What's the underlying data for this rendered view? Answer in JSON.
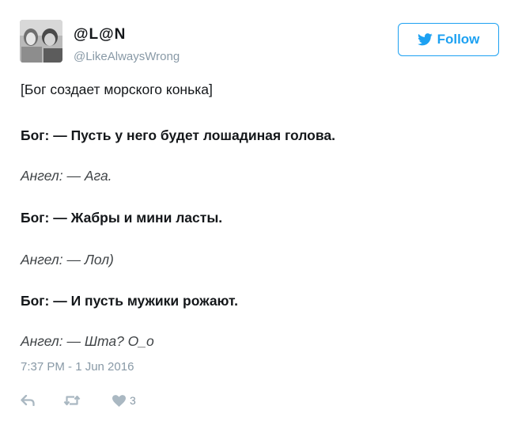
{
  "tweet": {
    "display_name": "@L@N",
    "handle": "@LikeAlwaysWrong",
    "follow_label": "Follow",
    "lines": [
      {
        "text": "[Бог создает морского конька]",
        "style": "plain"
      },
      {
        "text": "Бог: — Пусть у него будет лошадиная голова.",
        "style": "bold"
      },
      {
        "text": "Ангел: — Ага.",
        "style": "italic"
      },
      {
        "text": "Бог: — Жабры и мини ласты.",
        "style": "bold"
      },
      {
        "text": "Ангел: — Лол)",
        "style": "italic"
      },
      {
        "text": "Бог: — И пусть мужики рожают.",
        "style": "bold"
      },
      {
        "text": "Ангел: — Шта? О_о",
        "style": "italic"
      }
    ],
    "timestamp": "7:37 PM - 1 Jun 2016",
    "like_count": "3"
  },
  "icons": {
    "follow": "twitter-bird-icon",
    "reply": "reply-icon",
    "retweet": "retweet-icon",
    "like": "heart-icon"
  },
  "colors": {
    "accent": "#1da1f2",
    "muted": "#8899a6",
    "action_icon": "#aab8c2",
    "text": "#14171a"
  }
}
